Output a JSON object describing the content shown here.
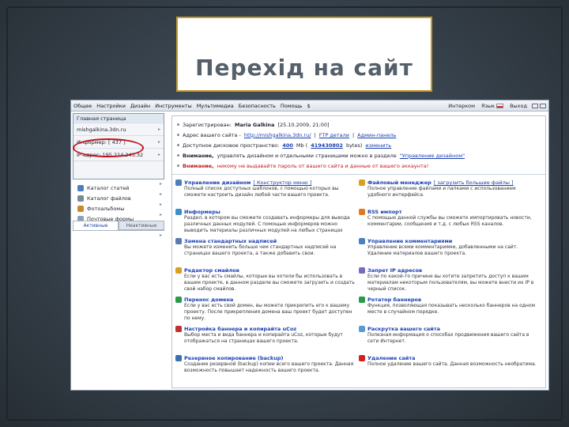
{
  "slide": {
    "title": "Перехід на сайт"
  },
  "menubar": {
    "items": [
      "Общее",
      "Настройки",
      "Дизайн",
      "Инструменты",
      "Мультимедиа",
      "Безопасность",
      "Помощь",
      "$"
    ],
    "right": {
      "interop": "Интерком",
      "lang": "Язык",
      "exit": "Выход"
    }
  },
  "dropdown": {
    "items": [
      "Главная страница",
      "mishgalkina.3dn.ru",
      "Информер: [ 437 ]",
      "IP-адрес: 195.214.243.32"
    ]
  },
  "sidebar": {
    "items": [
      {
        "label": "Каталог статей",
        "color": "#4a7fc1"
      },
      {
        "label": "Каталог файлов",
        "color": "#7a8a9a"
      },
      {
        "label": "Фотоальбомы",
        "color": "#c98a2a"
      },
      {
        "label": "Почтовые формы",
        "color": "#8aa0b8"
      }
    ],
    "tabs": {
      "active": "Активные",
      "inactive": "Неактивные"
    }
  },
  "info": {
    "registered_label": "Зарегистрирован:",
    "registered_user": "Maria Galkina",
    "registered_date": "[25.10.2009, 21:00]",
    "address_label": "Адрес вашего сайта -",
    "address_url": "http://mishgalkina.3dn.ru/",
    "ftp": "FTP детали",
    "admin": "Админ-панель",
    "space_prefix": "Доступное дисковое пространство:",
    "space_used": "400",
    "space_mid": "Mb (",
    "space_bytes": "419430802",
    "space_suffix": "bytes)",
    "space_change": "изменить",
    "warning1_label": "Внимание,",
    "warning1_text": "управлять дизайном и отдельными страницами можно в разделе",
    "warning1_link": "\"Управление дизайном\"",
    "warning2_label": "Внимание,",
    "warning2_text": "никому не выдавайте пароль от вашего сайта и данные от вашего аккаунта!"
  },
  "features_left": [
    {
      "title": "Управление дизайном",
      "extra": "[ Конструктор меню ]",
      "desc": "Полный список доступных шаблонов, с помощью которых вы сможете настроить дизайн любой части вашего проекта.",
      "color": "#4a7fc1"
    },
    {
      "title": "Информеры",
      "extra": "",
      "desc": "Раздел, в котором вы сможете создавать информеры для вывода различных данных модулей. С помощью информеров можно выводить материалы различных модулей на любых страницах сайта.",
      "color": "#3a8fc8"
    },
    {
      "title": "Замена стандартных надписей",
      "extra": "",
      "desc": "Вы можете изменить больше чем стандартных надписей на страницах вашего проекта, а также добавить свои.",
      "color": "#5a7ab0"
    },
    {
      "title": "Редактор смайлов",
      "extra": "",
      "desc": "Если у вас есть смайлы, которые вы хотели бы использовать в вашем проекте, в данном разделе вы сможете загрузить и создать свой набор смайлов.",
      "color": "#d9a020"
    },
    {
      "title": "Перенос домена",
      "extra": "",
      "desc": "Если у вас есть свой домен, вы можете прикрепить его к вашему проекту. После прикрепления домена ваш проект будет доступен по нему.",
      "color": "#2a9a4a"
    },
    {
      "title": "Настройка баннера и копирайта uCoz",
      "extra": "",
      "desc": "Выбор места и вида баннера и копирайта uCoz, которые будут отображаться на страницах вашего проекта.",
      "color": "#c03030"
    },
    {
      "title": "Резервное копирование (backup)",
      "extra": "",
      "desc": "Создание резервной (backup) копии всего вашего проекта. Данная возможность повышает надежность вашего проекта.",
      "color": "#3a70b0"
    }
  ],
  "features_right": [
    {
      "title": "Файловый менеджер",
      "extra": "[ загрузить большие файлы ]",
      "desc": "Полное управление файлами и папками с использованием удобного интерфейса.",
      "color": "#d9a020"
    },
    {
      "title": "RSS импорт",
      "extra": "",
      "desc": "С помощью данной службы вы сможете импортировать новости, комментарии, сообщения и т.д. с любых RSS каналов.",
      "color": "#e07a20"
    },
    {
      "title": "Управление комментариями",
      "extra": "",
      "desc": "Управление всеми комментариями, добавленными на сайт. Удаление материалов вашего проекта.",
      "color": "#4a7fc1"
    },
    {
      "title": "Запрет IP адресов",
      "extra": "",
      "desc": "Если по какой-то причине вы хотите запретить доступ к вашим материалам некоторым пользователям, вы можете внести их IP в черный список.",
      "color": "#7a6ac0"
    },
    {
      "title": "Ротатор баннеров",
      "extra": "",
      "desc": "Функция, позволяющая показывать несколько баннеров на одном месте в случайном порядке.",
      "color": "#2a9a4a"
    },
    {
      "title": "Раскрутка вашего сайта",
      "extra": "",
      "desc": "Полезная информация о способах продвижения вашего сайта в сети Интернет.",
      "color": "#5a9ad0"
    },
    {
      "title": "Удаление сайта",
      "extra": "",
      "desc": "Полное удаление вашего сайта. Данная возможность необратима.",
      "color": "#d02020"
    }
  ]
}
